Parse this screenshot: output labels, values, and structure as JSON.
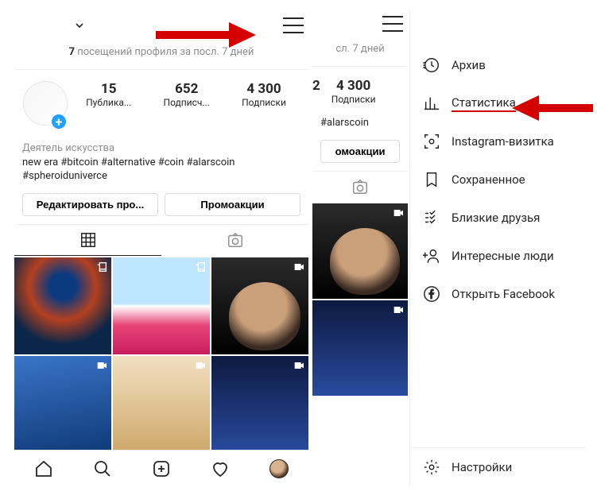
{
  "profile": {
    "visits_count": "7",
    "visits_text": "посещений профиля за посл. 7 дней",
    "visits_text_short": "сл. 7 дней",
    "stats": [
      {
        "num": "15",
        "lbl": "Публика..."
      },
      {
        "num": "652",
        "lbl": "Подписч..."
      },
      {
        "num": "4 300",
        "lbl": "Подписки"
      }
    ],
    "stats_right": [
      {
        "num": "2",
        "lbl": ""
      },
      {
        "num": "4 300",
        "lbl": "Подписки"
      }
    ],
    "category": "Деятель искусства",
    "bio_line1": "new era #bitcoin #alternative #coin #alarscoin",
    "bio_line2": "#spheroiduniverce",
    "bio_line_right": "#alarscoin",
    "edit_btn": "Редактировать про...",
    "promo_btn": "Промоакции",
    "promo_btn_short": "омоакции"
  },
  "menu": {
    "archive": "Архив",
    "stats": "Статистика",
    "nametag": "Instagram-визитка",
    "saved": "Сохраненное",
    "close": "Близкие друзья",
    "discover": "Интересные люди",
    "facebook": "Открыть Facebook",
    "settings": "Настройки"
  }
}
